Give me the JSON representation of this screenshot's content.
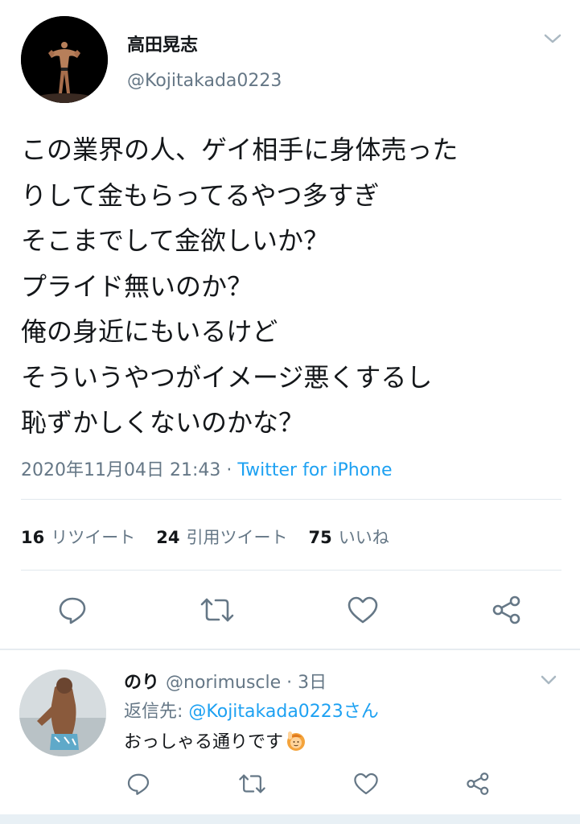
{
  "tweet": {
    "display_name": "高田晃志",
    "handle": "@Kojitakada0223",
    "text_lines": [
      "この業界の人、ゲイ相手に身体売った",
      "りして金もらってるやつ多すぎ",
      "そこまでして金欲しいか？",
      "プライド無いのか？",
      "俺の身近にもいるけど",
      "そういうやつがイメージ悪くするし",
      "恥ずかしくないのかな？"
    ],
    "timestamp": "2020年11月04日 21:43",
    "separator": " · ",
    "source": "Twitter for iPhone",
    "stats": {
      "retweets_count": "16",
      "retweets_label": "リツイート",
      "quotes_count": "24",
      "quotes_label": "引用ツイート",
      "likes_count": "75",
      "likes_label": "いいね"
    }
  },
  "reply": {
    "display_name": "のり",
    "handle": "@norimuscle",
    "time": "3日",
    "time_separator": " · ",
    "reply_to_label": "返信先: ",
    "reply_to_mention": "@Kojitakada0223さん",
    "text": "おっしゃる通りです"
  },
  "icons": [
    "chevron-down-icon",
    "reply-icon",
    "retweet-icon",
    "like-icon",
    "share-icon",
    "person-raising-hand-emoji"
  ],
  "colors": {
    "accent": "#1da1f2",
    "secondary_text": "#657786",
    "primary_text": "#14171a",
    "divider": "#e1e8ed"
  }
}
